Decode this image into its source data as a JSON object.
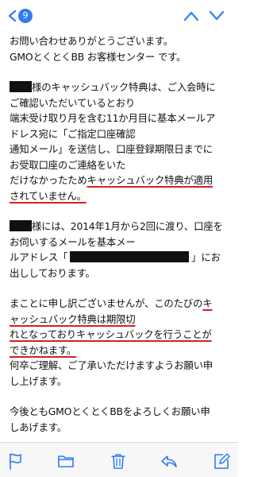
{
  "header": {
    "unread_count": "9"
  },
  "email": {
    "para1": [
      "お問い合わせありがとうございます。",
      "GMOとくとくBB お客様センター です。"
    ],
    "para2": {
      "line1_suffix": "様のキャッシュバック特典は、ご入会時に",
      "line2": "ご確認いただいているとおり",
      "line3": "端末受け取り月を含む11か月目に基本メールア",
      "line4": "ドレス宛に「ご指定口座確認",
      "line5": "通知メール」を送信し、口座登録期限日までに",
      "line6": "お受取口座のご連絡をいた",
      "line7_plain": "だけなかったため",
      "line7_hl": "キャッシュバック特典が適用",
      "line8_hl": "されていません。"
    },
    "para3": {
      "line1_suffix": "様には、2014年1月から2回に渡り、口座を",
      "line2": "お伺いするメールを基本メー",
      "line3_prefix": "ルアドレス「",
      "line3_suffix": "」にお",
      "line4": "出ししております。"
    },
    "para4": {
      "line1_plain": "まことに申し訳ございませんが、このたびの",
      "line1_hl": "キ",
      "line2_hl": "ャッシュバック特典は期限切",
      "line3_hl": "れとなっておりキャッシュバックを行うことが",
      "line4_hl": "できかねます。",
      "line5": "何卒ご理解、ご了承いただけますようお願い申",
      "line6": "し上げます。"
    },
    "para5": [
      "今後ともGMOとくとくBBをよろしくお願い申",
      "しあげます。"
    ]
  },
  "colors": {
    "accent": "#2f7cf6",
    "underline": "#d61f26"
  },
  "icons": {
    "back": "chevron-left-icon",
    "prev": "chevron-up-icon",
    "next": "chevron-down-icon",
    "flag": "flag-icon",
    "folder": "folder-icon",
    "trash": "trash-icon",
    "reply": "reply-icon",
    "compose": "compose-icon"
  }
}
